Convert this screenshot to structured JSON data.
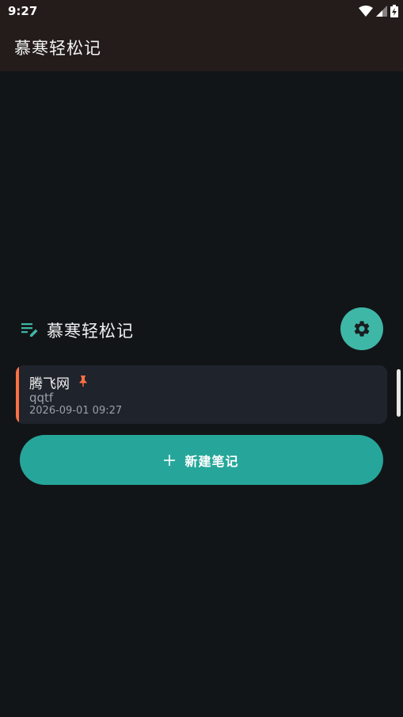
{
  "status_bar": {
    "time": "9:27",
    "icons": [
      "wifi-icon",
      "signal-icon",
      "battery-charging-icon"
    ]
  },
  "app_bar": {
    "title": "慕寒轻松记"
  },
  "header": {
    "icon": "notes-edit-icon",
    "title": "慕寒轻松记",
    "settings_icon": "gear-icon"
  },
  "notes": [
    {
      "title": "腾飞网",
      "pinned": true,
      "body": "qqtf",
      "date": "2026-09-01 09:27"
    }
  ],
  "new_note_button": {
    "icon": "plus-icon",
    "label": "新建笔记"
  },
  "colors": {
    "background": "#121518",
    "app_bar": "#231c1b",
    "accent_teal": "#26a69a",
    "settings_teal": "#3fb7a6",
    "pin_orange": "#ff7043",
    "card": "#1f232b"
  }
}
